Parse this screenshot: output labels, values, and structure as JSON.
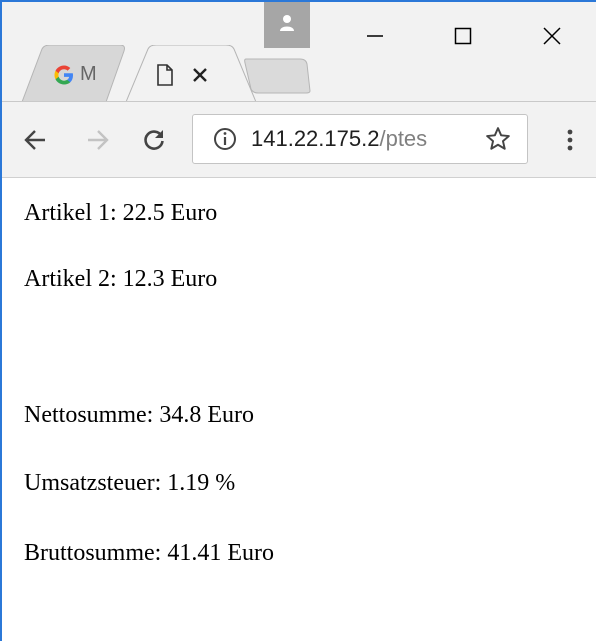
{
  "browser": {
    "tabs": [
      {
        "label": "M",
        "icon": "google-g-icon",
        "active": false
      },
      {
        "label": "",
        "icon": "page-icon",
        "active": true,
        "close_icon": "close-icon"
      },
      {
        "label": "",
        "icon": "new-tab-icon",
        "active": false
      }
    ],
    "window_controls": [
      "minimize-icon",
      "maximize-icon",
      "close-icon"
    ],
    "address": {
      "info_icon": "info-icon",
      "host": "141.22.175.2",
      "path": "/ptes",
      "star_icon": "star-icon"
    },
    "toolbar_icons": [
      "back-icon",
      "forward-icon",
      "reload-icon",
      "menu-icon"
    ],
    "colors": {
      "accent": "#2b78d8",
      "chrome": "#f2f2f2",
      "url_path": "#808080"
    }
  },
  "page": {
    "line1": "Artikel 1: 22.5 Euro",
    "line2": "Artikel 2: 12.3 Euro",
    "line3": "Nettosumme: 34.8 Euro",
    "line4": "Umsatzsteuer: 1.19 %",
    "line5": "Bruttosumme: 41.41 Euro"
  }
}
